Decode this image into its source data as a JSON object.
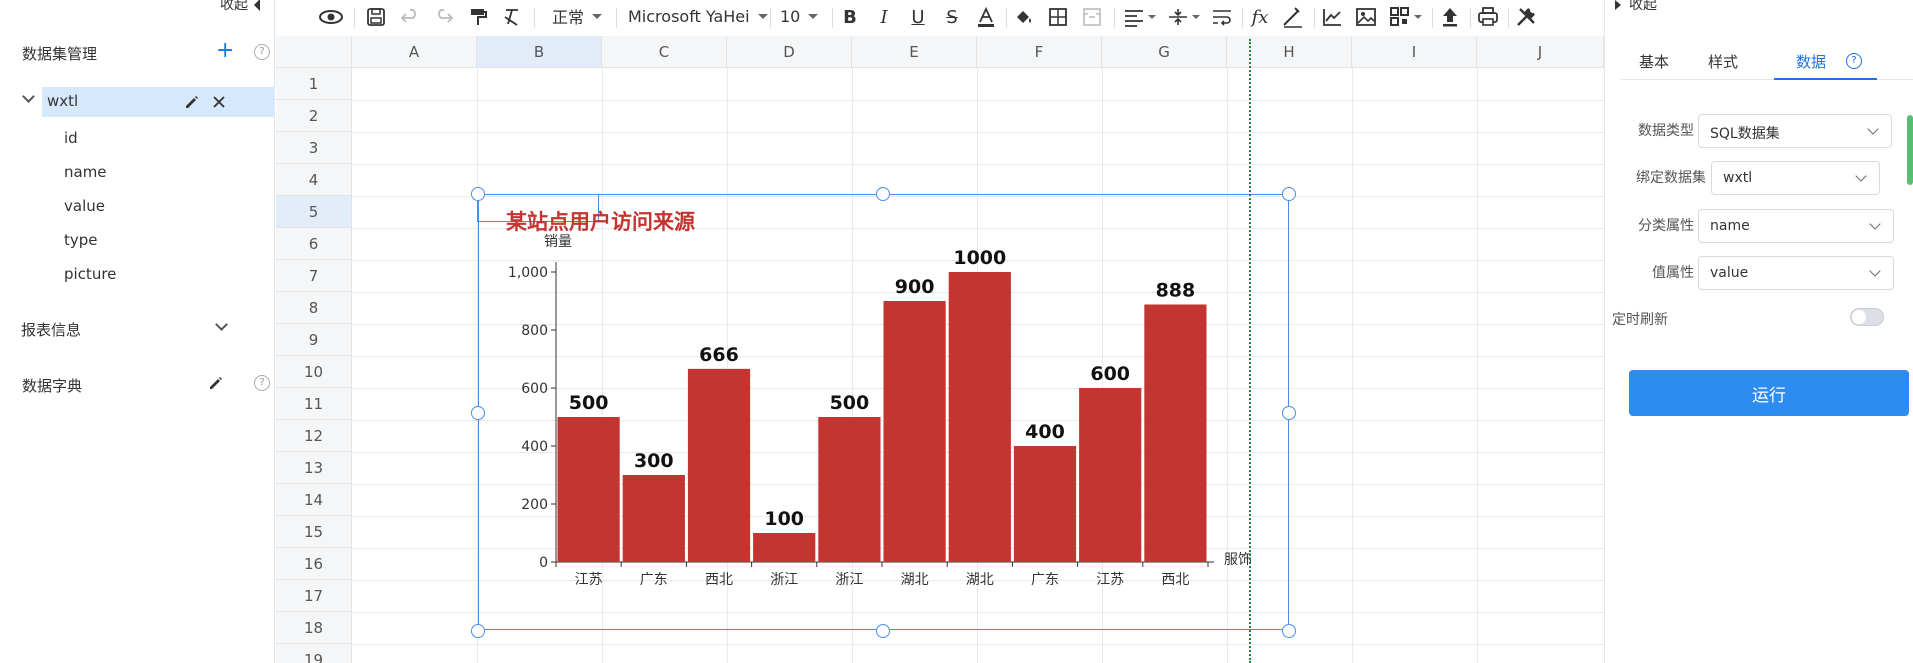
{
  "left_panel": {
    "collapse_label": "收起",
    "dataset_mgmt": "数据集管理",
    "dataset": {
      "name": "wxtl",
      "fields": [
        "id",
        "name",
        "value",
        "type",
        "picture"
      ]
    },
    "report_info": "报表信息",
    "data_dict": "数据字典"
  },
  "toolbar": {
    "style_select": "正常",
    "font_select": "Microsoft YaHei",
    "size_select": "10"
  },
  "grid": {
    "columns": [
      "A",
      "B",
      "C",
      "D",
      "E",
      "F",
      "G",
      "H",
      "I",
      "J"
    ],
    "rows": [
      "1",
      "2",
      "3",
      "4",
      "5",
      "6",
      "7",
      "8",
      "9",
      "10",
      "11",
      "12",
      "13",
      "14",
      "15",
      "16",
      "17",
      "18",
      "19"
    ]
  },
  "chart_data": {
    "type": "bar",
    "title": "某站点用户访问来源",
    "ylabel": "销量",
    "xlabel": "服饰",
    "categories": [
      "江苏",
      "广东",
      "西北",
      "浙江",
      "浙江",
      "湖北",
      "湖北",
      "广东",
      "江苏",
      "西北"
    ],
    "values": [
      500,
      300,
      666,
      100,
      500,
      900,
      1000,
      400,
      600,
      888
    ],
    "ylim": [
      0,
      1000
    ],
    "yticks": [
      "0",
      "200",
      "400",
      "600",
      "800",
      "1,000"
    ],
    "bar_color": "#c23531",
    "title_color": "#c23531",
    "grid": false
  },
  "right_panel": {
    "collapse_label": "收起",
    "tabs": [
      "基本",
      "样式",
      "数据"
    ],
    "active_tab": "数据",
    "data_type_label": "数据类型",
    "data_type_value": "SQL数据集",
    "bind_label": "绑定数据集",
    "bind_value": "wxtl",
    "category_label": "分类属性",
    "category_value": "name",
    "value_label": "值属性",
    "value_value": "value",
    "refresh_label": "定时刷新",
    "run_button": "运行"
  },
  "colors": {
    "accent": "#1a73e8",
    "button": "#2d8cf0",
    "selection": "#d6e8fb"
  }
}
